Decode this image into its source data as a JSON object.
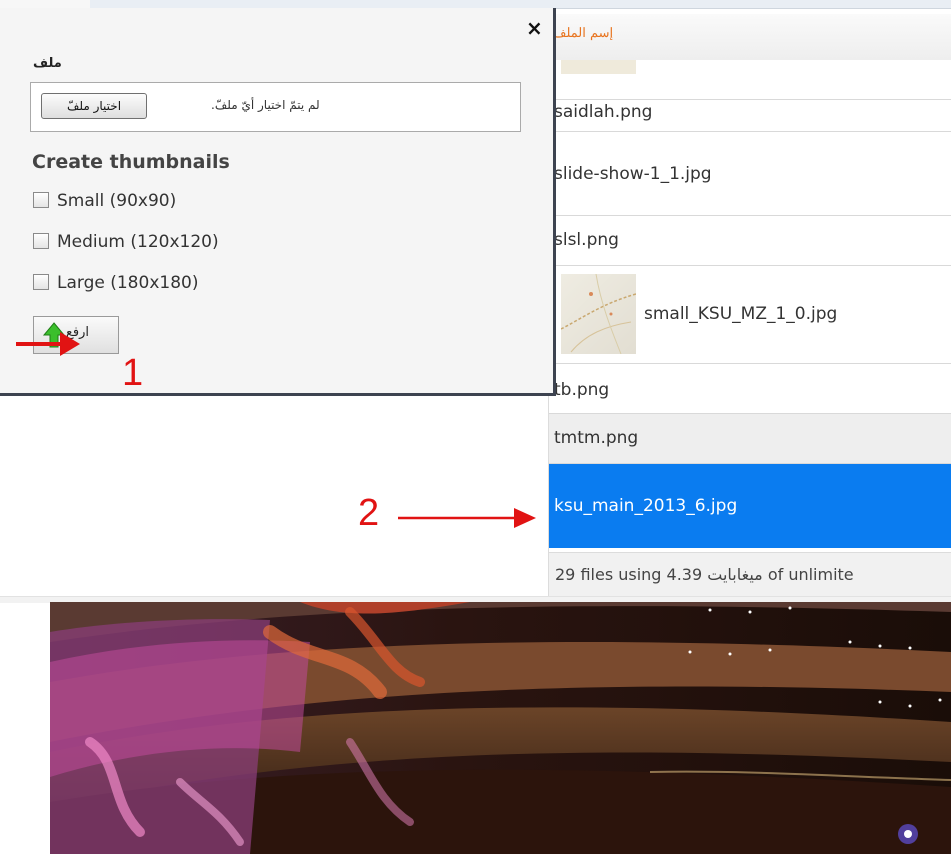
{
  "dialog": {
    "close_label": "×",
    "file_label": "ملف",
    "file_status": "لم يتمّ اختيار أيّ ملفّ.",
    "choose_file_label": "اختيار ملفّ",
    "thumbnails_title": "Create thumbnails",
    "options": [
      {
        "label": "Small (90x90)",
        "checked": false
      },
      {
        "label": "Medium (120x120)",
        "checked": false
      },
      {
        "label": "Large (180x180)",
        "checked": false
      }
    ],
    "upload_label": "ارفع"
  },
  "file_list": {
    "header": "إسم الملف",
    "rows": [
      "saidlah.png",
      "slide-show-1_1.jpg",
      "slsl.png",
      "small_KSU_MZ_1_0.jpg",
      "tb.png",
      "tmtm.png",
      "ksu_main_2013_6.jpg"
    ],
    "selected_index": 6,
    "footer": "29 files using 4.39 ميغابايت of unlimite"
  },
  "annotations": {
    "step1": "1",
    "step2": "2"
  },
  "colors": {
    "selected_row": "#0a7cf0",
    "header_text": "#e8731d",
    "annotation": "#e11313"
  }
}
